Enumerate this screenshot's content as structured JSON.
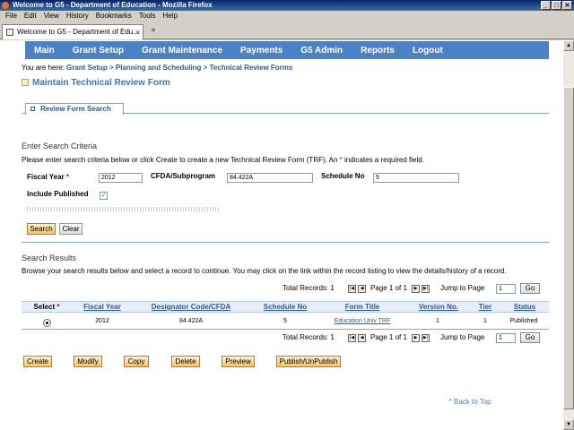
{
  "window": {
    "title": "Welcome to G5 - Department of Education - Mozilla Firefox",
    "controls": [
      "_",
      "□",
      "✕"
    ]
  },
  "menu": [
    "File",
    "Edit",
    "View",
    "History",
    "Bookmarks",
    "Tools",
    "Help"
  ],
  "browser_tab": {
    "label": "Welcome to G5 - Department of Edu...",
    "close": "✕",
    "new_tab": "+"
  },
  "nav": [
    "Main",
    "Grant Setup",
    "Grant Maintenance",
    "Payments",
    "G5 Admin",
    "Reports",
    "Logout"
  ],
  "breadcrumb": {
    "prefix": "You are here: ",
    "items": [
      "Grant Setup",
      "Planning and Scheduling",
      "Technical Review Forms"
    ],
    "separator": " > "
  },
  "page_title": "Maintain Technical Review Form",
  "subtab": "Review Form Search",
  "search": {
    "section_title": "Enter Search Criteria",
    "help_a": "Please enter search criteria below or click Create to create a new Technical Review Form (TRF). An ",
    "help_star": "*",
    "help_b": " indicates a required field.",
    "fiscal_year_label": "Fiscal Year",
    "required_mark": "*",
    "fiscal_year_value": "2012",
    "cfda_label": "CFDA/Subprogram",
    "cfda_value": "84.422A",
    "schedule_label": "Schedule No",
    "schedule_value": "5",
    "include_published_label": "Include Published",
    "include_published_checked": "✓",
    "search_button": "Search",
    "clear_button": "Clear"
  },
  "results": {
    "section_title": "Search Results",
    "help": "Browse your search results below and select a record to continue. You may click on the link within the record listing to view the details/history of a record.",
    "total_records": "Total Records: 1",
    "page_info": "Page 1 of 1",
    "jump_label": "Jump to Page",
    "jump_value": "1",
    "go_label": "Go",
    "pager_icons": {
      "first": "|◀",
      "prev": "◀",
      "next": "▶",
      "last": "▶|"
    },
    "headers": {
      "select": "Select",
      "fiscal_year": "Fiscal Year",
      "designator": "Designator Code/CFDA",
      "schedule": "Schedule No",
      "form_title": "Form Title",
      "version": "Version No.",
      "tier": "Tier",
      "status": "Status"
    },
    "rows": [
      {
        "fiscal_year": "2012",
        "designator": "84.422A",
        "schedule": "5",
        "form_title": "Education Univ TRF",
        "version": "1",
        "tier": "1",
        "status": "Published"
      }
    ]
  },
  "actions": [
    "Create",
    "Modify",
    "Copy",
    "Delete",
    "Preview",
    "Publish/UnPublish"
  ],
  "back_to_top": "^ Back to Top"
}
